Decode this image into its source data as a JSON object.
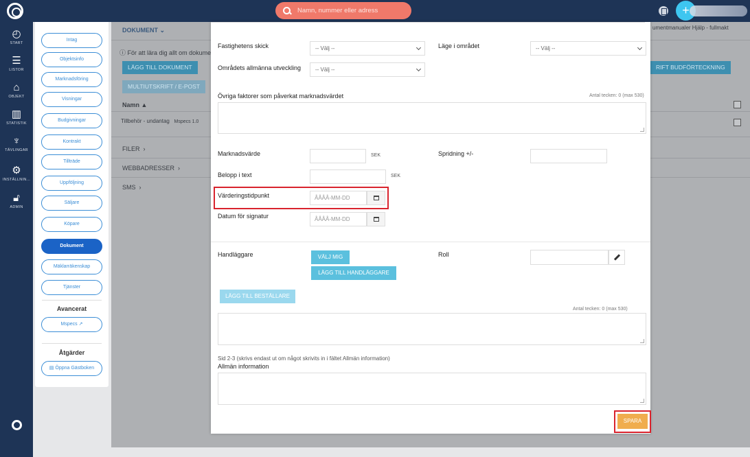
{
  "topbar": {
    "search_placeholder": "Namn, nummer eller adress"
  },
  "leftnav": [
    {
      "icon": "speedometer-icon",
      "label": "START"
    },
    {
      "icon": "list-icon",
      "label": "LISTOR"
    },
    {
      "icon": "house-icon",
      "label": "OBJEKT"
    },
    {
      "icon": "bar-chart-icon",
      "label": "STATISTIK"
    },
    {
      "icon": "trophy-icon",
      "label": "TÄVLINGAR"
    },
    {
      "icon": "gear-icon",
      "label": "INSTÄLLNIN..."
    },
    {
      "icon": "lock-icon",
      "label": "ADMIN"
    }
  ],
  "subnav": {
    "items": [
      "Intag",
      "Objektsinfo",
      "Marknadsföring",
      "Visningar",
      "Budgivningar",
      "Kontrakt",
      "Tillträde",
      "Uppföljning",
      "Säljare",
      "Köpare",
      "Dokument",
      "Mäklarräkenskap",
      "Tjänster"
    ],
    "active": "Dokument",
    "advanced_heading": "Avancerat",
    "mspecs": "Mspecs",
    "actions_heading": "Åtgärder",
    "open_guestbook": "Öppna Gästboken"
  },
  "background": {
    "section_title": "DOKUMENT",
    "info_text": "För att lära dig allt om dokumen",
    "add_doc_btn": "LÄGG TILL DOKUMENT",
    "multi_print_btn": "MULTIUTSKRIFT / E-POST",
    "right_links": "umentmanualer   Hjälp - fullmakt",
    "print_bid_btn": "RIFT BUDFÖRTECKNING",
    "name_header": "Namn",
    "row_text": "Tillbehör - undantag",
    "row_meta": "Mspecs  1.0",
    "files": "FILER",
    "web_addresses": "WEBBADRESSER",
    "sms": "SMS"
  },
  "modal": {
    "property_condition_label": "Fastighetens skick",
    "property_condition_value": "-- Välj --",
    "location_label": "Läge i området",
    "location_value": "-- Välj --",
    "area_development_label": "Områdets allmänna utveckling",
    "area_development_value": "-- Välj --",
    "other_factors_label": "Övriga faktorer som påverkat marknadsvärdet",
    "char_count_1": "Antal tecken: 0 (max 530)",
    "market_value_label": "Marknadsvärde",
    "market_value_unit": "SEK",
    "spread_label": "Spridning +/-",
    "amount_text_label": "Belopp i text",
    "amount_text_unit": "SEK",
    "valuation_date_label": "Värderingstidpunkt",
    "valuation_date_placeholder": "ÅÅÅÅ-MM-DD",
    "signature_date_label": "Datum för signatur",
    "signature_date_placeholder": "ÅÅÅÅ-MM-DD",
    "handler_label": "Handläggare",
    "choose_me_btn": "VÄLJ MIG",
    "add_handler_btn": "LÄGG TILL HANDLÄGGARE",
    "role_label": "Roll",
    "add_orderer_btn": "LÄGG TILL BESTÄLLARE",
    "char_count_2": "Antal tecken: 0 (max 530)",
    "page_note": "Sid 2-3 (skrivs endast ut om något skrivits in i fältet Allmän information)",
    "general_info_label": "Allmän information",
    "save_btn": "SPARA"
  },
  "colors": {
    "navy": "#1e3456",
    "accent_blue": "#1b63c6",
    "cyan": "#5bc0de",
    "orange": "#f0ad4e",
    "highlight_red": "#d9232d"
  }
}
